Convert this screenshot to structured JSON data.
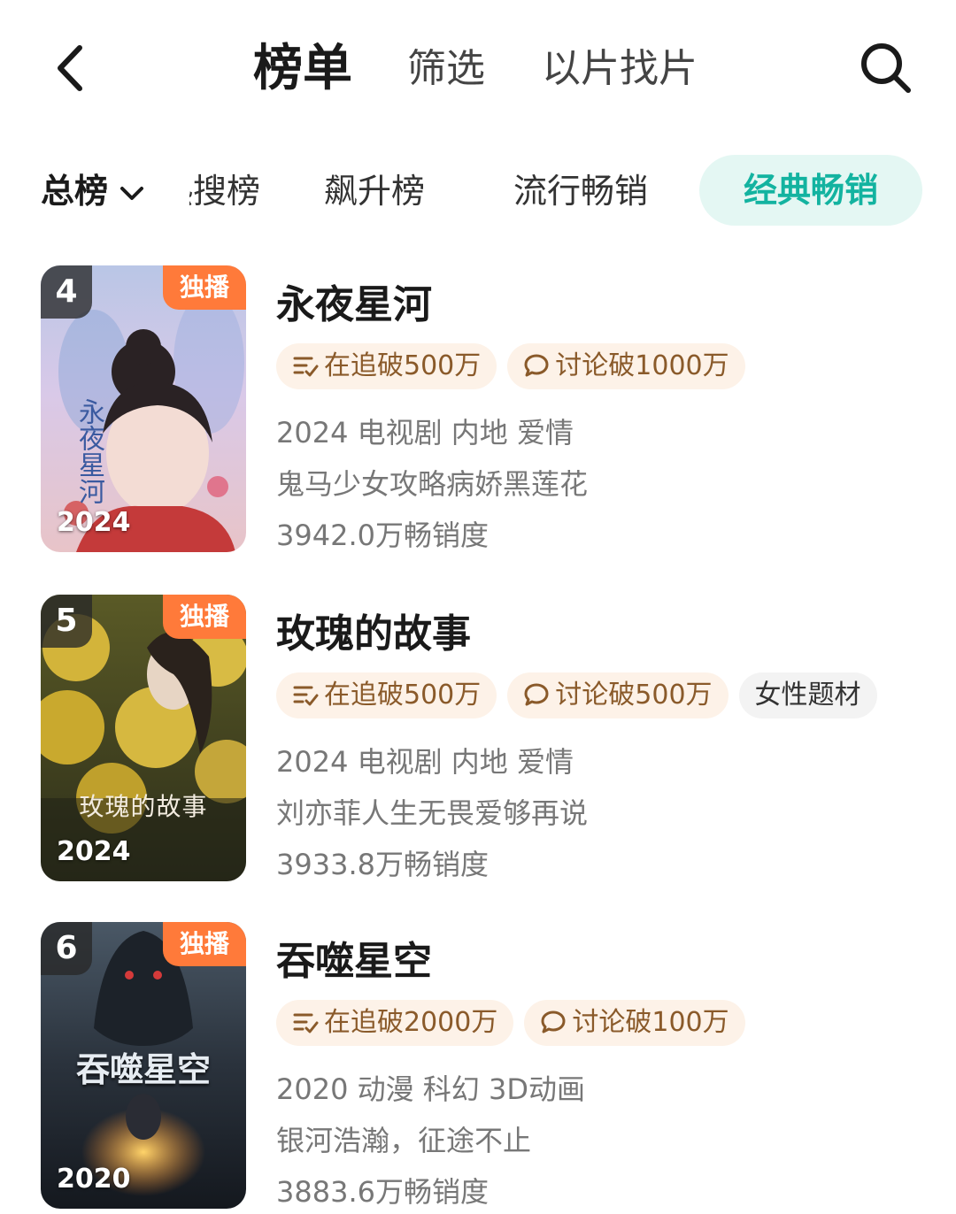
{
  "header": {
    "tabs": [
      "榜单",
      "筛选",
      "以片找片"
    ],
    "active_tab": "榜单"
  },
  "subtabs": {
    "main_label": "总榜",
    "items": [
      "热搜榜",
      "飙升榜",
      "流行畅销",
      "经典畅销"
    ],
    "visible_first_fragment": "搜榜",
    "active": "经典畅销"
  },
  "colors": {
    "accent": "#13b3a0",
    "accent_bg": "#e4f7f3",
    "exclusive_badge": "#ff7a3a",
    "tag_bg": "#fdf2e8",
    "tag_text": "#8a5a2a"
  },
  "list": [
    {
      "rank": "4",
      "badge": "独播",
      "year": "2024",
      "title": "永夜星河",
      "tags": [
        {
          "icon": "follow-list-icon",
          "text": "在追破500万"
        },
        {
          "icon": "comment-bubble-icon",
          "text": "讨论破1000万"
        }
      ],
      "meta": "2024 电视剧 内地 爱情",
      "desc": "鬼马少女攻略病娇黑莲花",
      "sales": "3942.0万畅销度",
      "poster_text": "永夜星河"
    },
    {
      "rank": "5",
      "badge": "独播",
      "year": "2024",
      "title": "玫瑰的故事",
      "tags": [
        {
          "icon": "follow-list-icon",
          "text": "在追破500万"
        },
        {
          "icon": "comment-bubble-icon",
          "text": "讨论破500万"
        },
        {
          "icon": "",
          "text": "女性题材"
        }
      ],
      "meta": "2024 电视剧 内地 爱情",
      "desc": "刘亦菲人生无畏爱够再说",
      "sales": "3933.8万畅销度",
      "poster_text": "玫瑰的故事"
    },
    {
      "rank": "6",
      "badge": "独播",
      "year": "2020",
      "title": "吞噬星空",
      "tags": [
        {
          "icon": "follow-list-icon",
          "text": "在追破2000万"
        },
        {
          "icon": "comment-bubble-icon",
          "text": "讨论破100万"
        }
      ],
      "meta": "2020 动漫 科幻 3D动画",
      "desc": "银河浩瀚，征途不止",
      "sales": "3883.6万畅销度",
      "poster_text": "吞噬星空"
    }
  ]
}
